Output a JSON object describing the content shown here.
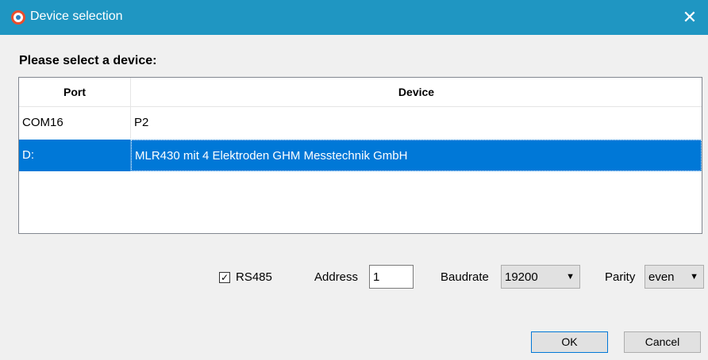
{
  "window": {
    "title": "Device selection",
    "close_glyph": "✕",
    "accent_color": "#1f96c2"
  },
  "prompt": "Please select a device:",
  "table": {
    "columns": [
      "Port",
      "Device"
    ],
    "rows": [
      {
        "port": "COM16",
        "device": "P2",
        "selected": false
      },
      {
        "port": "D:",
        "device": "MLR430 mit 4 Elektroden GHM Messtechnik GmbH",
        "selected": true
      }
    ],
    "selection_color": "#0078d7"
  },
  "settings": {
    "rs485": {
      "label": "RS485",
      "checked": true,
      "check_glyph": "✓"
    },
    "address": {
      "label": "Address",
      "value": "1"
    },
    "baudrate": {
      "label": "Baudrate",
      "value": "19200"
    },
    "parity": {
      "label": "Parity",
      "value": "even"
    },
    "dropdown_glyph": "▼"
  },
  "buttons": {
    "ok": "OK",
    "cancel": "Cancel"
  }
}
